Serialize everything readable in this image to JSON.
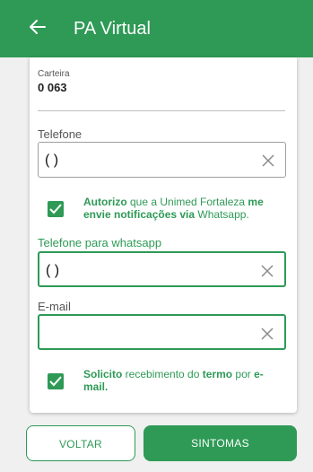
{
  "header": {
    "title": "PA Virtual",
    "back_icon": "arrow-left-icon"
  },
  "carteira": {
    "label": "Carteira",
    "value": "0 063"
  },
  "telefone": {
    "label": "Telefone",
    "value": "(  )"
  },
  "whatsapp_consent": {
    "checked": true,
    "part1": "Autorizo",
    "part2": " que a Unimed Fortaleza ",
    "part3": "me envie notificações via",
    "part4": " Whatsapp."
  },
  "telefone_whatsapp": {
    "label": "Telefone para whatsapp",
    "value": "(  )"
  },
  "email": {
    "label": "E-mail",
    "value": ""
  },
  "termo_consent": {
    "checked": true,
    "part1": "Solicito",
    "part2": " recebimento do ",
    "part3": "termo",
    "part4": " por ",
    "part5": "e-mail."
  },
  "buttons": {
    "voltar": "VOLTAR",
    "sintomas": "SINTOMAS"
  },
  "colors": {
    "primary": "#2e9a56",
    "background": "#f0f0f0"
  }
}
